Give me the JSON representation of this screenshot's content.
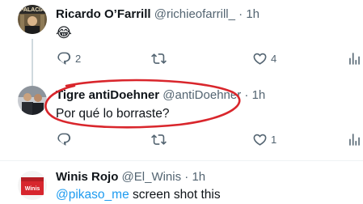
{
  "tweets": [
    {
      "name": "Ricardo O’Farrill",
      "handle": "@richieofarrill_",
      "dot": "·",
      "time": "1h",
      "text": "😂",
      "avatar_text": "PALACIA",
      "replies": "2",
      "retweets": "",
      "likes": "4"
    },
    {
      "name": "Tigre antiDoehner",
      "handle": "@antiDoehner",
      "dot": "·",
      "time": "1h",
      "text": "Por qué lo borraste?",
      "replies": "",
      "retweets": "",
      "likes": "1"
    },
    {
      "name": "Winis Rojo",
      "handle": "@El_Winis",
      "dot": "·",
      "time": "1h",
      "mention": "@pikaso_me",
      "text_rest": " screen shot this",
      "avatar_text": "Winis"
    }
  ],
  "colors": {
    "text_primary": "#0f1419",
    "text_secondary": "#536471",
    "mention": "#1d9bf0",
    "highlight_ellipse": "#d9262c",
    "thread_line": "#cfd9de"
  },
  "icons": [
    "reply-icon",
    "retweet-icon",
    "like-icon",
    "views-icon"
  ]
}
